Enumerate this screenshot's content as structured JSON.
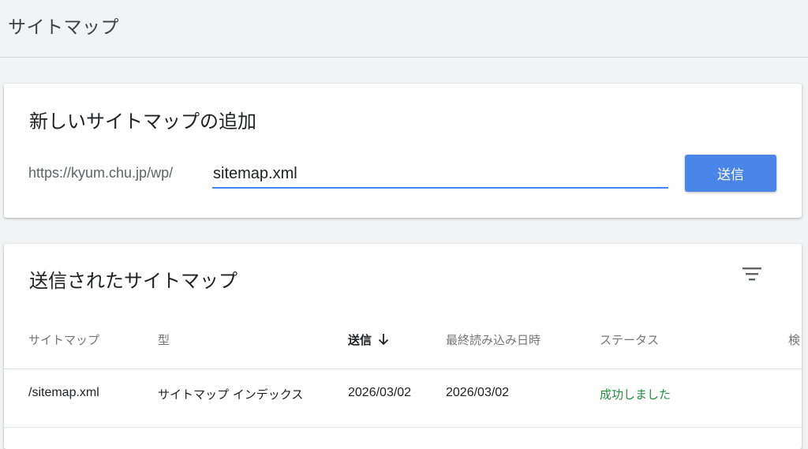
{
  "page": {
    "title": "サイトマップ"
  },
  "add_card": {
    "title": "新しいサイトマップの追加",
    "url_prefix": "https://kyum.chu.jp/wp/",
    "input_value": "sitemap.xml",
    "submit_label": "送信",
    "accent_color": "#4a86e8"
  },
  "list_card": {
    "title": "送信されたサイトマップ",
    "filter_icon": "filter-icon",
    "columns": [
      "サイトマップ",
      "型",
      "送信",
      "最終読み込み日時",
      "ステータス",
      "検"
    ],
    "sort_column": "送信",
    "sort_direction": "descending",
    "rows": [
      {
        "sitemap": "/sitemap.xml",
        "type": "サイトマップ インデックス",
        "submitted": "2026/03/02",
        "last_read": "2026/03/02",
        "status": "成功しました"
      }
    ],
    "status_color": "#1e8e3e"
  }
}
